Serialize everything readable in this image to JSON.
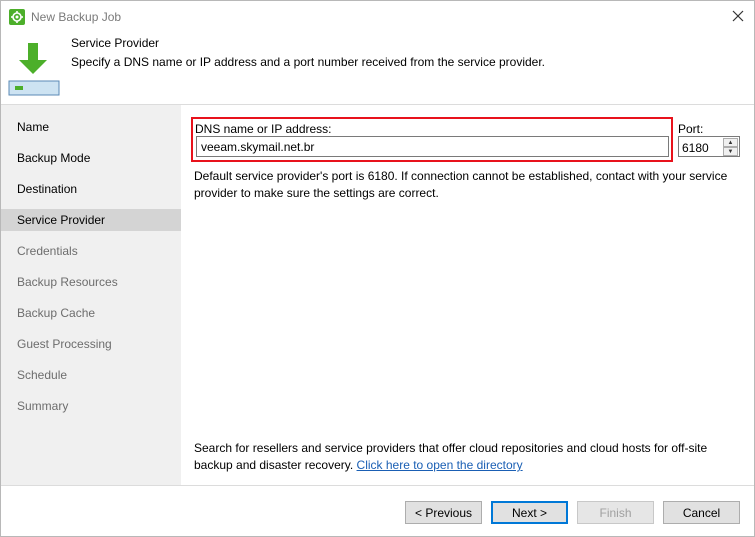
{
  "window": {
    "title": "New Backup Job",
    "app_icon": "veeam-gear-icon",
    "close_icon": "close-icon"
  },
  "header": {
    "title": "Service Provider",
    "subtitle": "Specify a DNS name or IP address and a port number received from the service provider.",
    "icon": "download-to-drive-icon"
  },
  "sidebar": {
    "items": [
      {
        "label": "Name",
        "state": "done"
      },
      {
        "label": "Backup Mode",
        "state": "done"
      },
      {
        "label": "Destination",
        "state": "done"
      },
      {
        "label": "Service Provider",
        "state": "active"
      },
      {
        "label": "Credentials",
        "state": "future"
      },
      {
        "label": "Backup Resources",
        "state": "future"
      },
      {
        "label": "Backup Cache",
        "state": "future"
      },
      {
        "label": "Guest Processing",
        "state": "future"
      },
      {
        "label": "Schedule",
        "state": "future"
      },
      {
        "label": "Summary",
        "state": "future"
      }
    ]
  },
  "form": {
    "dns_label": "DNS name or IP address:",
    "dns_value": "veeam.skymail.net.br",
    "port_label": "Port:",
    "port_value": "6180",
    "description": "Default service provider's port is 6180. If connection cannot be established, contact with your service provider to make sure the settings are correct.",
    "search_text": "Search for resellers and service providers that offer cloud repositories and cloud hosts for off-site backup and disaster recovery.",
    "search_link": "Click here to open the directory"
  },
  "footer": {
    "previous_label": "< Previous",
    "next_label": "Next >",
    "finish_label": "Finish",
    "cancel_label": "Cancel"
  },
  "colors": {
    "highlight": "#e8121c",
    "link": "#1a5fb4",
    "icon_green": "#4caf2a",
    "sidebar_bg": "#f0f0f0",
    "sidebar_active": "#d4d4d4"
  }
}
